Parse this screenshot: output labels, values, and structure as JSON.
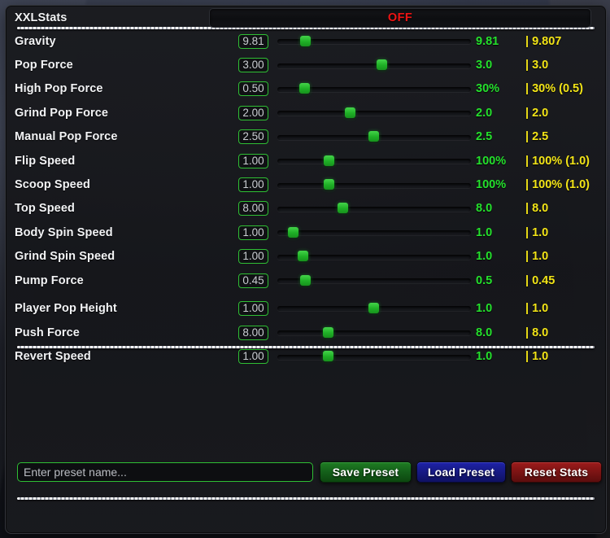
{
  "window": {
    "title": "XXLStats"
  },
  "toggle": {
    "label": "XXLStats",
    "state": "OFF",
    "state_color": "#f01414"
  },
  "colors": {
    "accent_green": "#24e02c",
    "default_yellow": "#f2e417",
    "input_border": "#2fbf34",
    "thumb": "#1fb026",
    "save": "#14601a",
    "load": "#171a85",
    "reset": "#7d1414"
  },
  "main_stats": [
    {
      "label": "Gravity",
      "input": "9.81",
      "current": "9.81",
      "default": "| 9.807",
      "slider_pct": 14.3
    },
    {
      "label": "Pop Force",
      "input": "3.00",
      "current": "3.0",
      "default": "| 3.0",
      "slider_pct": 54.2
    },
    {
      "label": "High Pop Force",
      "input": "0.50",
      "current": "30%",
      "default": "| 30% (0.5)",
      "slider_pct": 13.9
    },
    {
      "label": "Grind Pop Force",
      "input": "2.00",
      "current": "2.0",
      "default": "| 2.0",
      "slider_pct": 37.4
    },
    {
      "label": "Manual Pop Force",
      "input": "2.50",
      "current": "2.5",
      "default": "| 2.5",
      "slider_pct": 49.6
    },
    {
      "label": "Flip Speed",
      "input": "1.00",
      "current": "100%",
      "default": "| 100% (1.0)",
      "slider_pct": 26.5
    },
    {
      "label": "Scoop Speed",
      "input": "1.00",
      "current": "100%",
      "default": "| 100% (1.0)",
      "slider_pct": 26.5
    },
    {
      "label": "Top Speed",
      "input": "8.00",
      "current": "8.0",
      "default": "| 8.0",
      "slider_pct": 34.0
    },
    {
      "label": "Body Spin Speed",
      "input": "1.00",
      "current": "1.0",
      "default": "| 1.0",
      "slider_pct": 8.0
    },
    {
      "label": "Grind Spin Speed",
      "input": "1.00",
      "current": "1.0",
      "default": "| 1.0",
      "slider_pct": 13.4
    },
    {
      "label": "Pump Force",
      "input": "0.45",
      "current": "0.5",
      "default": "| 0.45",
      "slider_pct": 14.3
    }
  ],
  "secondary_stats": [
    {
      "label": "Player Pop Height",
      "input": "1.00",
      "current": "1.0",
      "default": "| 1.0",
      "slider_pct": 49.6
    },
    {
      "label": "Push Force",
      "input": "8.00",
      "current": "8.0",
      "default": "| 8.0",
      "slider_pct": 26.1
    },
    {
      "label": "Revert Speed",
      "input": "1.00",
      "current": "1.0",
      "default": "| 1.0",
      "slider_pct": 26.1
    }
  ],
  "preset_bar": {
    "input_value": "",
    "input_placeholder": "Enter preset name...",
    "save_label": "Save Preset",
    "load_label": "Load Preset",
    "reset_label": "Reset Stats"
  }
}
